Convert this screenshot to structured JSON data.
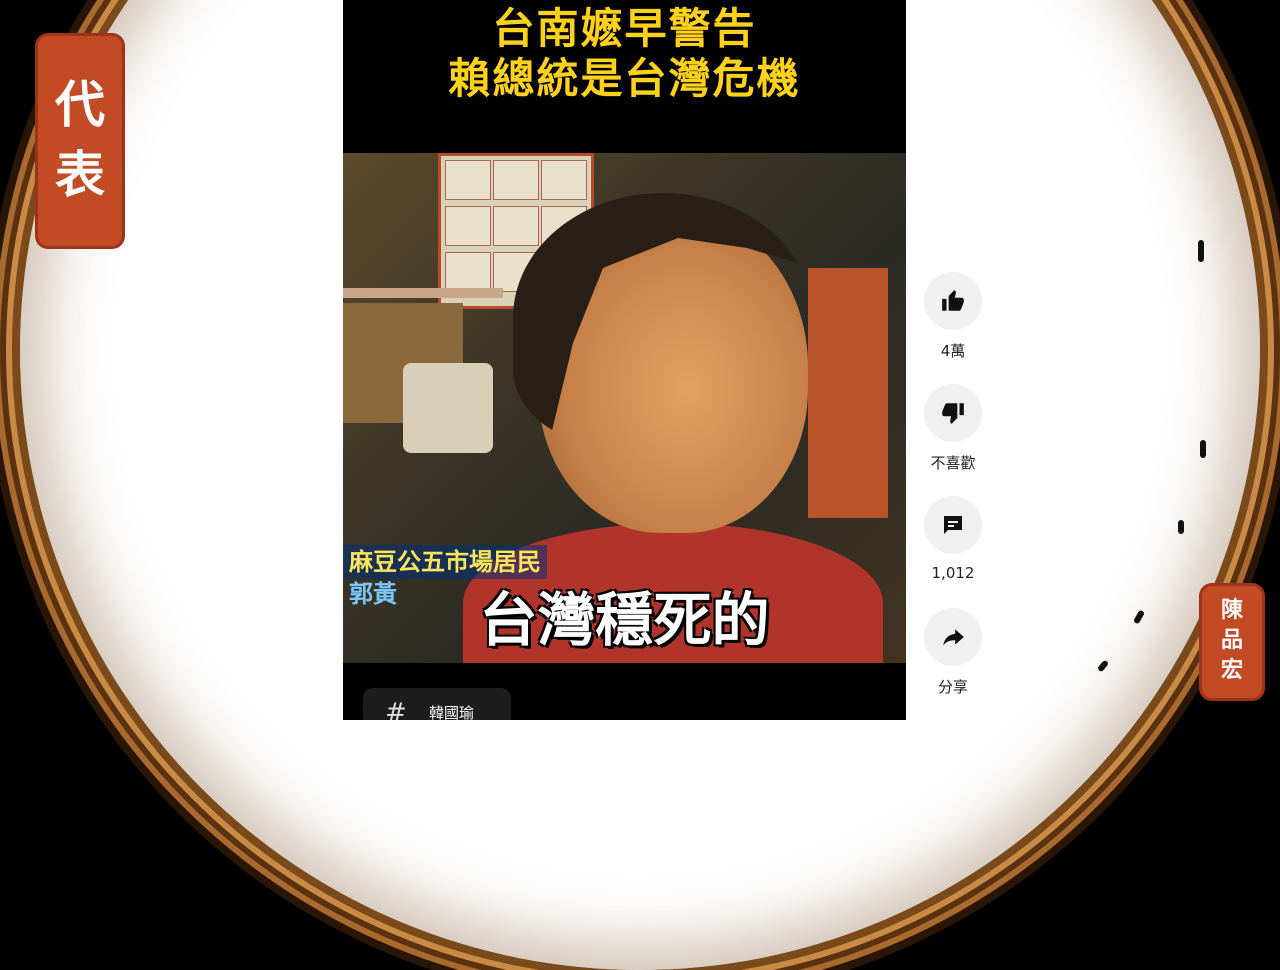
{
  "video": {
    "headline_line1": "台南嬷早警告",
    "headline_line2": "賴總統是台灣危機",
    "lower_third_title": "麻豆公五市場居民",
    "lower_third_name": "郭黃",
    "subtitle": "台灣穩死的",
    "hashtag_symbol": "#",
    "hashtag_text": "韓國瑜"
  },
  "actions": {
    "like_count": "4萬",
    "dislike_label": "不喜歡",
    "comment_count": "1,012",
    "share_label": "分享"
  },
  "seals": {
    "left": [
      "代",
      "表"
    ],
    "right": [
      "陳",
      "品",
      "宏"
    ]
  },
  "colors": {
    "headline": "#ffd21a",
    "seal": "#c24a24",
    "frame": "#a86a2e"
  }
}
